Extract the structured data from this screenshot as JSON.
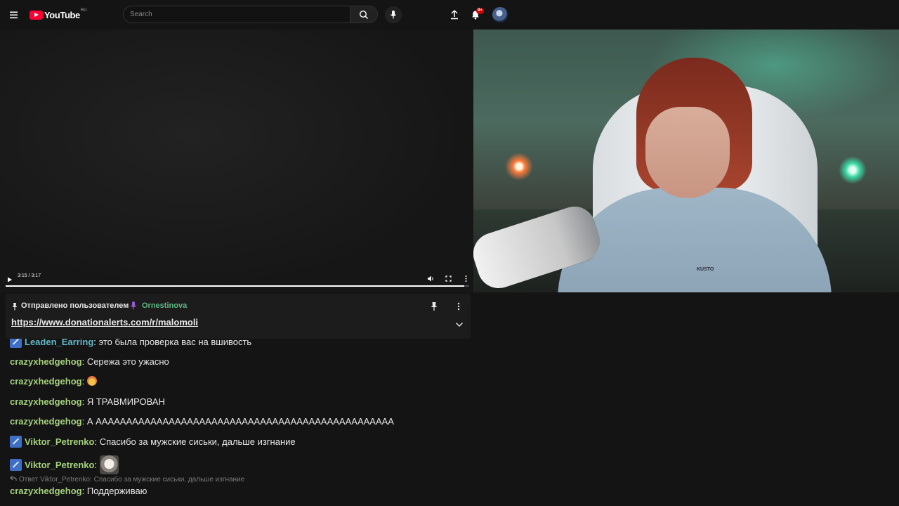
{
  "header": {
    "logo_text": "YouTube",
    "region": "RU",
    "search_placeholder": "Search",
    "notification_count": "9+"
  },
  "player": {
    "time": "3:15 / 3:17",
    "progress": 0.99
  },
  "pinned": {
    "label": "Отправлено пользователем",
    "user": "Ornestinova",
    "link": "https://www.donationalerts.com/r/malomoli"
  },
  "chat": {
    "messages": [
      {
        "user": "Leaden_Earring",
        "text": ": это была проверка вас на вшивость"
      },
      {
        "user": "crazyxhedgehog",
        "text": ": Сережа это ужасно"
      },
      {
        "user": "crazyxhedgehog",
        "text": ": "
      },
      {
        "user": "crazyxhedgehog",
        "text": ": Я ТРАВМИРОВАН"
      },
      {
        "user": "crazyxhedgehog",
        "text": ": А ААААААААААААААААААААААААААААААААААААААААААААААААА"
      },
      {
        "user": "Viktor_Petrenko",
        "text": ": Спасибо за мужские сиськи, дальше изгнание"
      },
      {
        "user": "Viktor_Petrenko",
        "text": ": "
      },
      {
        "user": "crazyxhedgehog",
        "text": ": Поддерживаю"
      }
    ],
    "reply_to": "Ответ Viktor_Petrenko: Спасибо за мужские сиськи, дальше изгнание"
  },
  "webcam": {
    "shirt_brand": "KUSTO"
  },
  "colors": {
    "accent": "#ff0033",
    "chat_user_green": "#a4d07d",
    "chat_user_teal": "#5fb8c8",
    "pinned_user": "#5fb884",
    "mod_badge": "#3f6fc4"
  }
}
